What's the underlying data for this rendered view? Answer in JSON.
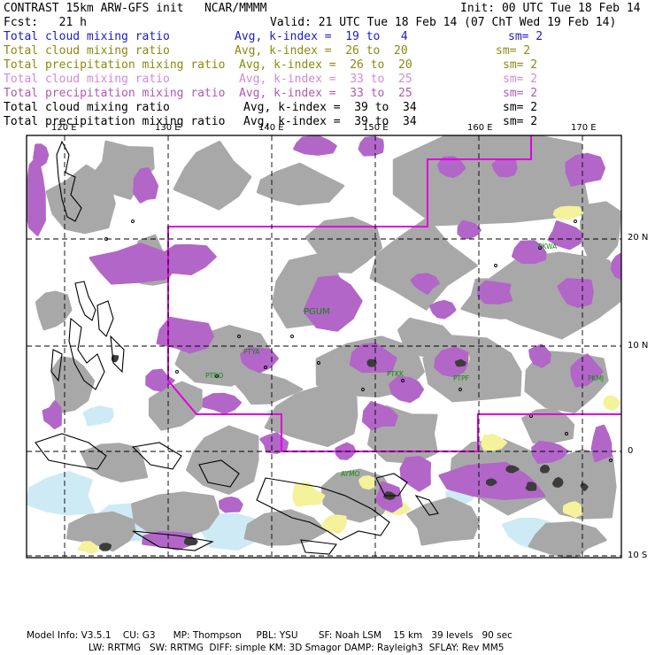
{
  "header": {
    "title": "CONTRAST 15km ARW-GFS init   NCAR/MMMM",
    "init": "Init: 00 UTC Tue 18 Feb 14",
    "fcst": "Fcst:   21 h",
    "valid": "Valid: 21 UTC Tue 18 Feb 14 (07 ChT Wed 19 Feb 14)"
  },
  "fields": [
    {
      "name": "Total cloud mixing ratio",
      "avg": "Avg, k-index =  19 to   4",
      "sm": "sm= 2",
      "color": "#1a1acc"
    },
    {
      "name": "Total cloud mixing ratio",
      "avg": "Avg, k-index =  26 to  20",
      "sm": "sm= 2",
      "color": "#8a8a10"
    },
    {
      "name": "Total precipitation mixing ratio",
      "avg": "Avg, k-index =  26 to  20",
      "sm": "sm= 2",
      "color": "#8a8a10"
    },
    {
      "name": "Total cloud mixing ratio",
      "avg": "Avg, k-index =  33 to  25",
      "sm": "sm= 2",
      "color": "#d48ad4"
    },
    {
      "name": "Total precipitation mixing ratio",
      "avg": "Avg, k-index =  33 to  25",
      "sm": "sm= 2",
      "color": "#b05ab0"
    },
    {
      "name": "Total cloud mixing ratio",
      "avg": "Avg, k-index =  39 to  34",
      "sm": "sm= 2",
      "color": "#000000"
    },
    {
      "name": "Total precipitation mixing ratio",
      "avg": "Avg, k-index =  39 to  34",
      "sm": "sm= 2",
      "color": "#000000"
    }
  ],
  "map": {
    "lon_labels": [
      "120 E",
      "130 E",
      "140 E",
      "150 E",
      "160 E",
      "170 E"
    ],
    "lat_labels": [
      "20 N",
      "10 N",
      "0",
      "10 S"
    ],
    "stations": [
      "PTYA",
      "PGUM",
      "PTRO",
      "PTKK",
      "PTPF",
      "PKMJ",
      "PKWA",
      "AYMO"
    ],
    "colors": {
      "cloud_gray": "#a8a8a8",
      "dark_core": "#3c3c3c",
      "precip_purple": "#b266c8",
      "light_blue": "#cdeaf5",
      "yellow": "#f4f29a",
      "boundary_magenta": "#e000e0",
      "station_green": "#0a8a0a"
    }
  },
  "footer": {
    "line1": "Model Info: V3.5.1    CU: G3      MP: Thompson     PBL: YSU       SF: Noah LSM    15 km   39 levels   90 sec",
    "line2": "LW: RRTMG   SW: RRTMG  DIFF: simple KM: 3D Smagor DAMP: Rayleigh3  SFLAY: Rev MM5"
  }
}
